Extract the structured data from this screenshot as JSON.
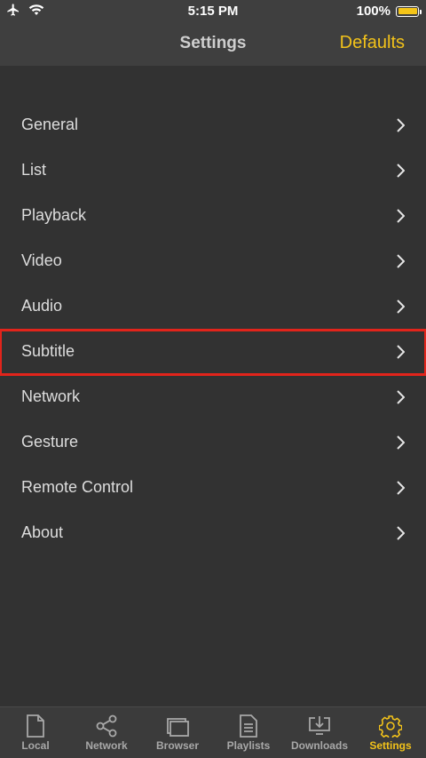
{
  "status_bar": {
    "time": "5:15 PM",
    "battery": "100%"
  },
  "nav": {
    "title": "Settings",
    "defaults": "Defaults"
  },
  "menu": [
    {
      "label": "General"
    },
    {
      "label": "List"
    },
    {
      "label": "Playback"
    },
    {
      "label": "Video"
    },
    {
      "label": "Audio"
    },
    {
      "label": "Subtitle"
    },
    {
      "label": "Network"
    },
    {
      "label": "Gesture"
    },
    {
      "label": "Remote Control"
    },
    {
      "label": "About"
    }
  ],
  "tabs": [
    {
      "label": "Local",
      "icon": "document-icon"
    },
    {
      "label": "Network",
      "icon": "share-icon"
    },
    {
      "label": "Browser",
      "icon": "browser-icon"
    },
    {
      "label": "Playlists",
      "icon": "playlist-icon"
    },
    {
      "label": "Downloads",
      "icon": "download-icon"
    },
    {
      "label": "Settings",
      "icon": "gear-icon"
    }
  ],
  "colors": {
    "accent": "#f2c21a",
    "highlight": "#e2241b",
    "background": "#323232"
  }
}
